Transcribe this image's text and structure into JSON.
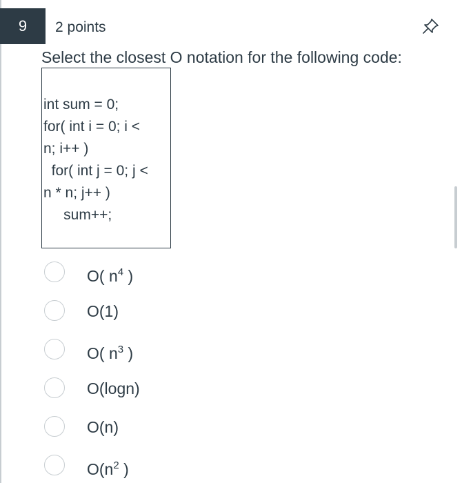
{
  "question": {
    "number": "9",
    "points": "2 points",
    "pin_icon": "pin-icon",
    "prompt": "Select the closest O notation for the following code:",
    "code_lines": [
      "int sum = 0;",
      "for( int i = 0; i <",
      "n; i++ )",
      "  for( int j = 0; j <",
      "n * n; j++ )",
      "     sum++;"
    ]
  },
  "answers": [
    {
      "base": "O( n",
      "sup": "4",
      "tail": " )"
    },
    {
      "base": "O(1)",
      "sup": "",
      "tail": ""
    },
    {
      "base": "O( n",
      "sup": "3",
      "tail": " )"
    },
    {
      "base": "O(logn)",
      "sup": "",
      "tail": ""
    },
    {
      "base": "O(n)",
      "sup": "",
      "tail": ""
    },
    {
      "base": "O(n",
      "sup": "2",
      "tail": " )"
    }
  ],
  "colors": {
    "text": "#2d3b45",
    "badge_bg": "#2d3b45",
    "radio_border": "#c7cdd1"
  }
}
